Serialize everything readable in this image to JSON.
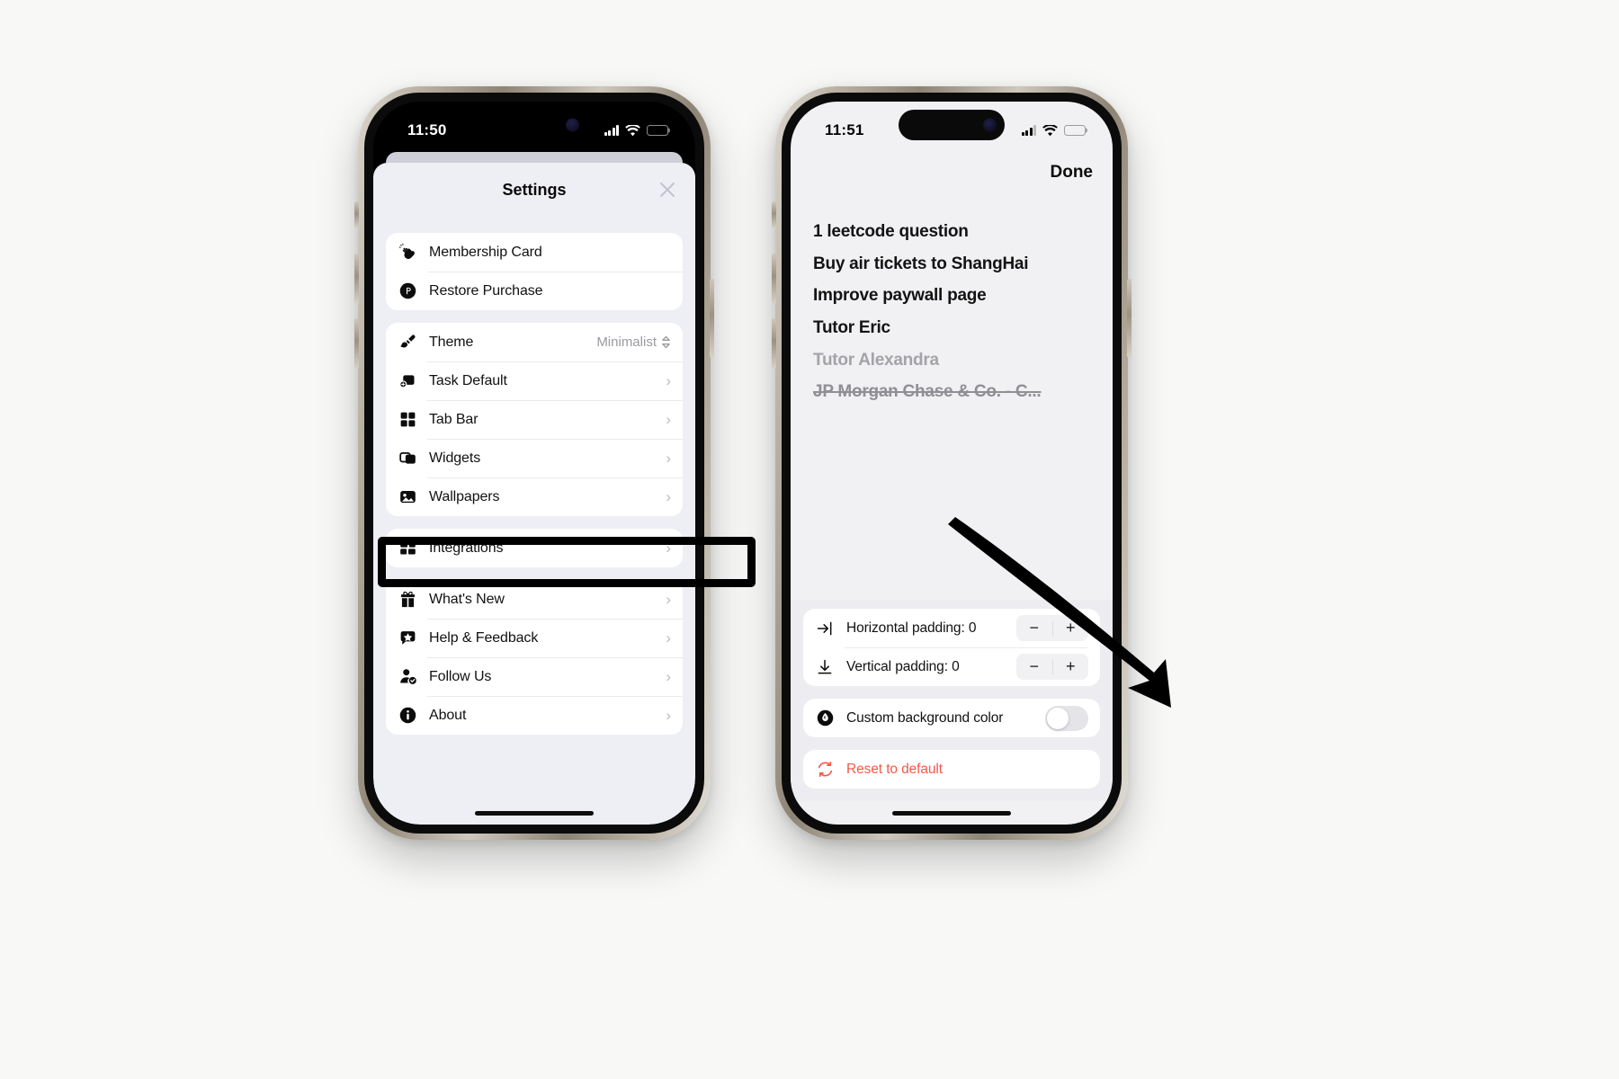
{
  "page": {
    "background_color": "#f8f8f7"
  },
  "phone_left": {
    "status_bar": {
      "time": "11:50",
      "signal_icon": "cellular-bars-icon",
      "wifi_icon": "wifi-icon",
      "battery_icon": "battery-icon"
    },
    "sheet": {
      "title": "Settings",
      "close_icon": "close-icon",
      "groups": [
        {
          "rows": [
            {
              "icon": "clapping-hands-icon",
              "label": "Membership Card",
              "accessory": "none"
            },
            {
              "icon": "restore-purchase-icon",
              "label": "Restore Purchase",
              "accessory": "none"
            }
          ]
        },
        {
          "rows": [
            {
              "icon": "paintbrush-icon",
              "label": "Theme",
              "accessory": "value",
              "value": "Minimalist",
              "value_icon": "chevron-updown-icon"
            },
            {
              "icon": "task-default-icon",
              "label": "Task Default",
              "accessory": "chevron",
              "chevron": "›"
            },
            {
              "icon": "tab-bar-grid-icon",
              "label": "Tab Bar",
              "accessory": "chevron",
              "chevron": "›"
            },
            {
              "icon": "widgets-icon",
              "label": "Widgets",
              "accessory": "chevron",
              "chevron": "›",
              "highlighted": true
            },
            {
              "icon": "wallpapers-image-icon",
              "label": "Wallpapers",
              "accessory": "chevron",
              "chevron": "›"
            }
          ]
        },
        {
          "rows": [
            {
              "icon": "integrations-grid-icon",
              "label": "Integrations",
              "accessory": "chevron",
              "chevron": "›"
            }
          ]
        },
        {
          "rows": [
            {
              "icon": "gift-icon",
              "label": "What's New",
              "accessory": "chevron",
              "chevron": "›"
            },
            {
              "icon": "help-feedback-icon",
              "label": "Help & Feedback",
              "accessory": "chevron",
              "chevron": "›"
            },
            {
              "icon": "follow-us-person-icon",
              "label": "Follow Us",
              "accessory": "chevron",
              "chevron": "›"
            },
            {
              "icon": "about-info-icon",
              "label": "About",
              "accessory": "chevron",
              "chevron": "›"
            }
          ]
        }
      ]
    }
  },
  "phone_right": {
    "status_bar": {
      "time": "11:51",
      "signal_icon": "cellular-bars-icon",
      "wifi_icon": "wifi-icon",
      "battery_icon": "battery-icon"
    },
    "done_label": "Done",
    "tasks": [
      {
        "text": "1 leetcode question",
        "state": "active"
      },
      {
        "text": "Buy air tickets to ShangHai",
        "state": "active"
      },
      {
        "text": "Improve paywall page",
        "state": "active"
      },
      {
        "text": "Tutor Eric",
        "state": "active"
      },
      {
        "text": "Tutor Alexandra",
        "state": "dim"
      },
      {
        "text": "JP Morgan Chase & Co. - C...",
        "state": "completed"
      }
    ],
    "controls": {
      "padding_rows": [
        {
          "icon": "horizontal-padding-icon",
          "label": "Horizontal padding: 0",
          "minus": "−",
          "plus": "+"
        },
        {
          "icon": "vertical-padding-icon",
          "label": "Vertical padding: 0",
          "minus": "−",
          "plus": "+"
        }
      ],
      "toggle_row": {
        "icon": "custom-color-icon",
        "label": "Custom background color",
        "state": "off"
      },
      "reset_row": {
        "icon": "reset-circular-arrows-icon",
        "label": "Reset to default",
        "color": "#f2594b"
      }
    }
  },
  "annotation": {
    "arrow_icon": "pointer-arrow-icon",
    "color": "#000000"
  }
}
